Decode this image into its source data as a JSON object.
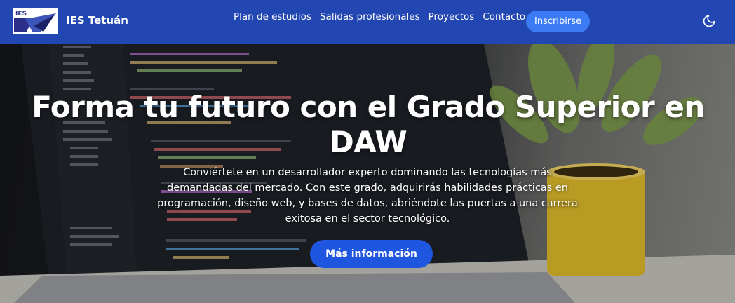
{
  "brand": {
    "logo_text": "IES",
    "name": "IES Tetuán"
  },
  "nav": {
    "links": [
      {
        "label": "Plan de estudios"
      },
      {
        "label": "Salidas profesionales"
      },
      {
        "label": "Proyectos"
      },
      {
        "label": "Contacto"
      }
    ],
    "cta_label": "Inscribirse",
    "theme_icon": "moon-icon"
  },
  "hero": {
    "title": "Forma tu futuro con el Grado Superior en DAW",
    "text": "Conviértete en un desarrollador experto dominando las tecnologías más demandadas del mercado. Con este grado, adquirirás habilidades prácticas en programación, diseño web, y bases de datos, abriéndote las puertas a una carrera exitosa en el sector tecnológico.",
    "button_label": "Más información"
  },
  "colors": {
    "navbar": "#2347b2",
    "nav_cta": "#3b7cf6",
    "hero_button": "#1f56e0",
    "text": "#ffffff"
  }
}
